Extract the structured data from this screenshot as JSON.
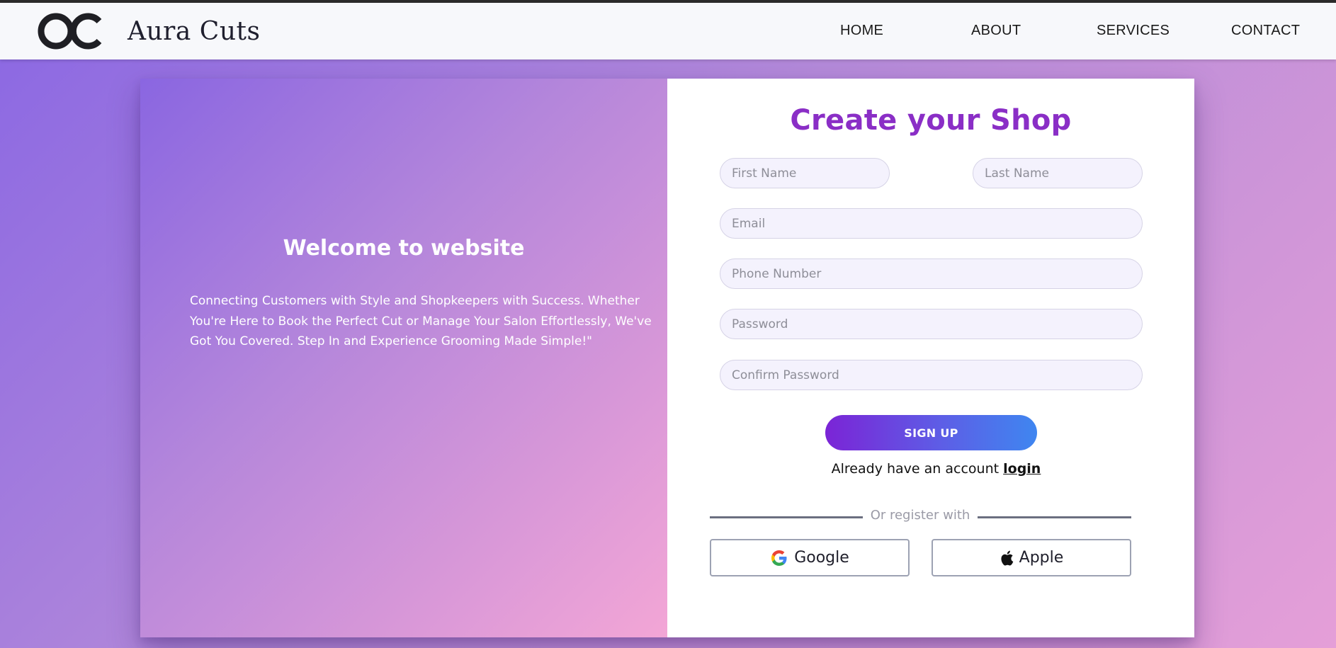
{
  "navbar": {
    "brand": "Aura Cuts",
    "logo_icon": "aura-cuts-logo",
    "links": [
      {
        "label": "HOME"
      },
      {
        "label": "ABOUT"
      },
      {
        "label": "SERVICES"
      },
      {
        "label": "CONTACT"
      }
    ]
  },
  "left_panel": {
    "welcome": "Welcome to website",
    "tagline": "Connecting Customers with Style and Shopkeepers with Success. Whether You're Here to Book the Perfect Cut or Manage Your Salon Effortlessly, We've Got You Covered. Step In and Experience Grooming Made Simple!\""
  },
  "form": {
    "title": "Create your Shop",
    "fields": {
      "first_name": {
        "placeholder": "First Name",
        "value": ""
      },
      "last_name": {
        "placeholder": "Last Name",
        "value": ""
      },
      "email": {
        "placeholder": "Email",
        "value": ""
      },
      "phone": {
        "placeholder": "Phone Number",
        "value": ""
      },
      "password": {
        "placeholder": "Password",
        "value": ""
      },
      "confirm_password": {
        "placeholder": "Confirm Password",
        "value": ""
      }
    },
    "signup_label": "SIGN UP",
    "login_prompt": "Already have an account",
    "login_link": "login",
    "divider_text": "Or register with",
    "google_label": "Google",
    "apple_label": "Apple",
    "google_icon": "google-icon",
    "apple_icon": "apple-icon"
  },
  "colors": {
    "title": "#8a2ec6",
    "button_start": "#7b24d6",
    "button_end": "#3f86f0",
    "background_start": "#8a67e3",
    "background_end": "#e59fd8"
  }
}
